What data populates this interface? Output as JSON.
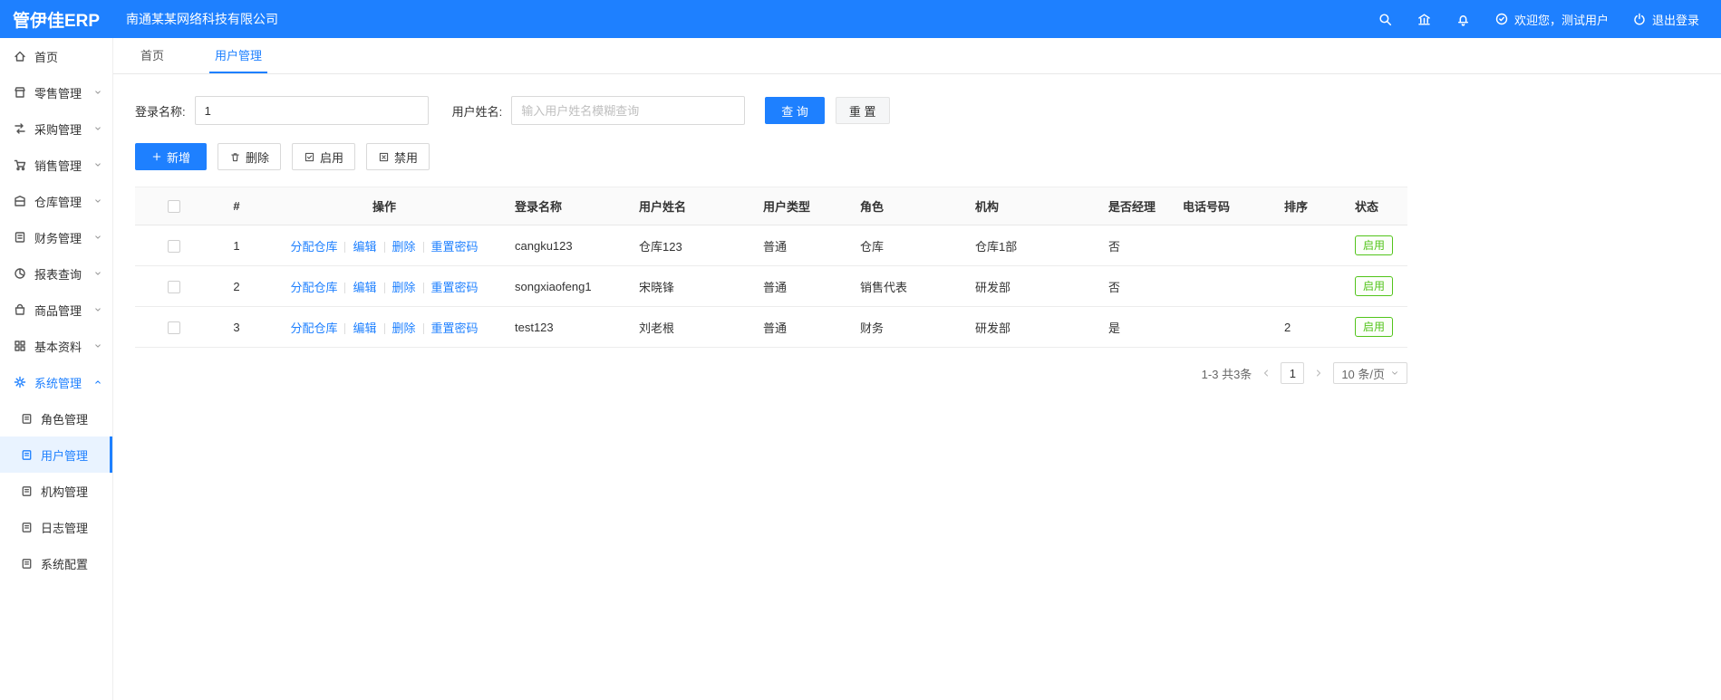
{
  "colors": {
    "accent": "#1E80FF",
    "success": "#52C41A"
  },
  "topbar": {
    "logo": "管伊佳ERP",
    "company": "南通某某网络科技有限公司",
    "welcome": "欢迎您，测试用户",
    "logout": "退出登录"
  },
  "sidebar": {
    "items": [
      {
        "label": "首页"
      },
      {
        "label": "零售管理"
      },
      {
        "label": "采购管理"
      },
      {
        "label": "销售管理"
      },
      {
        "label": "仓库管理"
      },
      {
        "label": "财务管理"
      },
      {
        "label": "报表查询"
      },
      {
        "label": "商品管理"
      },
      {
        "label": "基本资料"
      },
      {
        "label": "系统管理"
      }
    ],
    "submenu": [
      {
        "label": "角色管理"
      },
      {
        "label": "用户管理"
      },
      {
        "label": "机构管理"
      },
      {
        "label": "日志管理"
      },
      {
        "label": "系统配置"
      }
    ]
  },
  "tabs": [
    "首页",
    "用户管理"
  ],
  "filters": {
    "login_label": "登录名称:",
    "login_value": "1",
    "name_label": "用户姓名:",
    "name_placeholder": "输入用户姓名模糊查询",
    "search_label": "查 询",
    "reset_label": "重 置"
  },
  "toolbar": {
    "add_label": "新增",
    "delete_label": "删除",
    "enable_label": "启用",
    "disable_label": "禁用"
  },
  "table": {
    "headers": [
      "#",
      "操作",
      "登录名称",
      "用户姓名",
      "用户类型",
      "角色",
      "机构",
      "是否经理",
      "电话号码",
      "排序",
      "状态"
    ],
    "op_links": [
      "分配仓库",
      "编辑",
      "删除",
      "重置密码"
    ],
    "rows": [
      {
        "index": "1",
        "login": "cangku123",
        "name": "仓库123",
        "type": "普通",
        "role": "仓库",
        "org": "仓库1部",
        "manager": "否",
        "phone": "",
        "sort": "",
        "status": "启用"
      },
      {
        "index": "2",
        "login": "songxiaofeng1",
        "name": "宋晓锋",
        "type": "普通",
        "role": "销售代表",
        "org": "研发部",
        "manager": "否",
        "phone": "",
        "sort": "",
        "status": "启用"
      },
      {
        "index": "3",
        "login": "test123",
        "name": "刘老根",
        "type": "普通",
        "role": "财务",
        "org": "研发部",
        "manager": "是",
        "phone": "",
        "sort": "2",
        "status": "启用"
      }
    ]
  },
  "pagination": {
    "total": "1-3 共3条",
    "page": "1",
    "page_size": "10 条/页"
  }
}
